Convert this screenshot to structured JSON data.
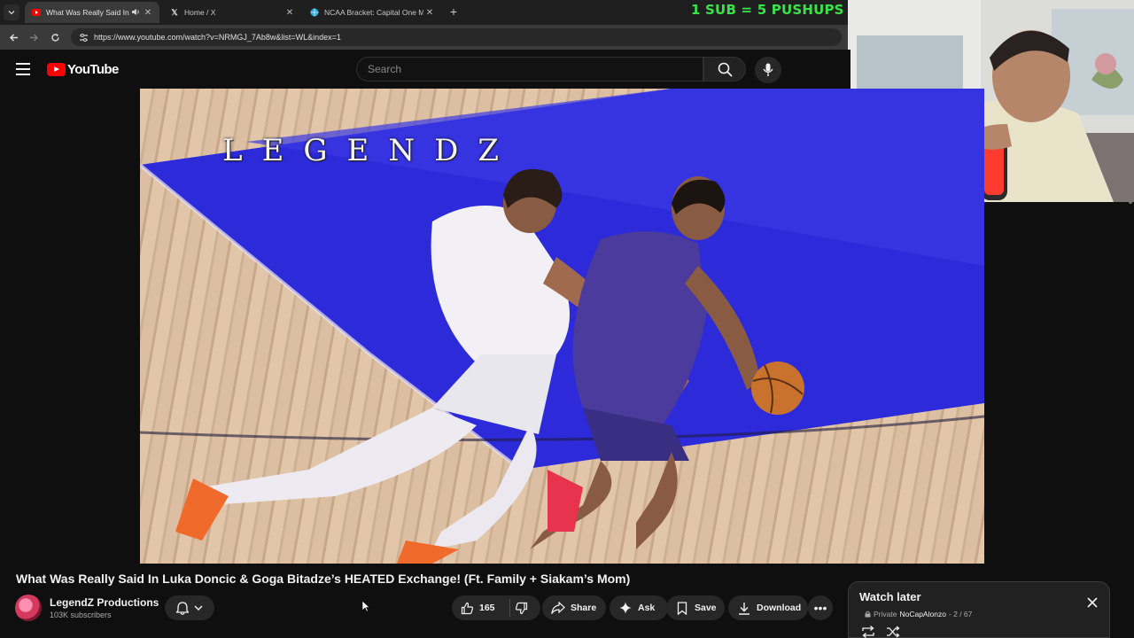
{
  "browser": {
    "tabs": [
      {
        "title": "What Was Really Said In Lu"
      },
      {
        "title": "Home / X"
      },
      {
        "title": "NCAA Bracket: Capital One Ma"
      }
    ],
    "url": "https://www.youtube.com/watch?v=NRMGJ_7Ab8w&list=WL&index=1"
  },
  "overlay": {
    "stream_text": "1 SUB = 5 PUSHUPS"
  },
  "youtube": {
    "logo_text": "YouTube",
    "search_placeholder": "Search"
  },
  "video": {
    "watermark": "LEGENDZ",
    "title": "What Was Really Said In Luka Doncic & Goga Bitadze’s HEATED Exchange! (Ft. Family + Siakam’s Mom)"
  },
  "channel": {
    "name": "LegendZ Productions",
    "subscribers": "103K subscribers"
  },
  "actions": {
    "like_count": "165",
    "share_label": "Share",
    "ask_label": "Ask",
    "save_label": "Save",
    "download_label": "Download"
  },
  "playlist": {
    "title": "Watch later",
    "privacy": "Private",
    "owner": "NoCapAlonzo",
    "position": "- 2 / 67"
  },
  "colors": {
    "accent_red": "#ff0000",
    "overlay_green": "#39e34a",
    "court_blue": "#2d2bd9",
    "background": "#0f0f0f"
  }
}
